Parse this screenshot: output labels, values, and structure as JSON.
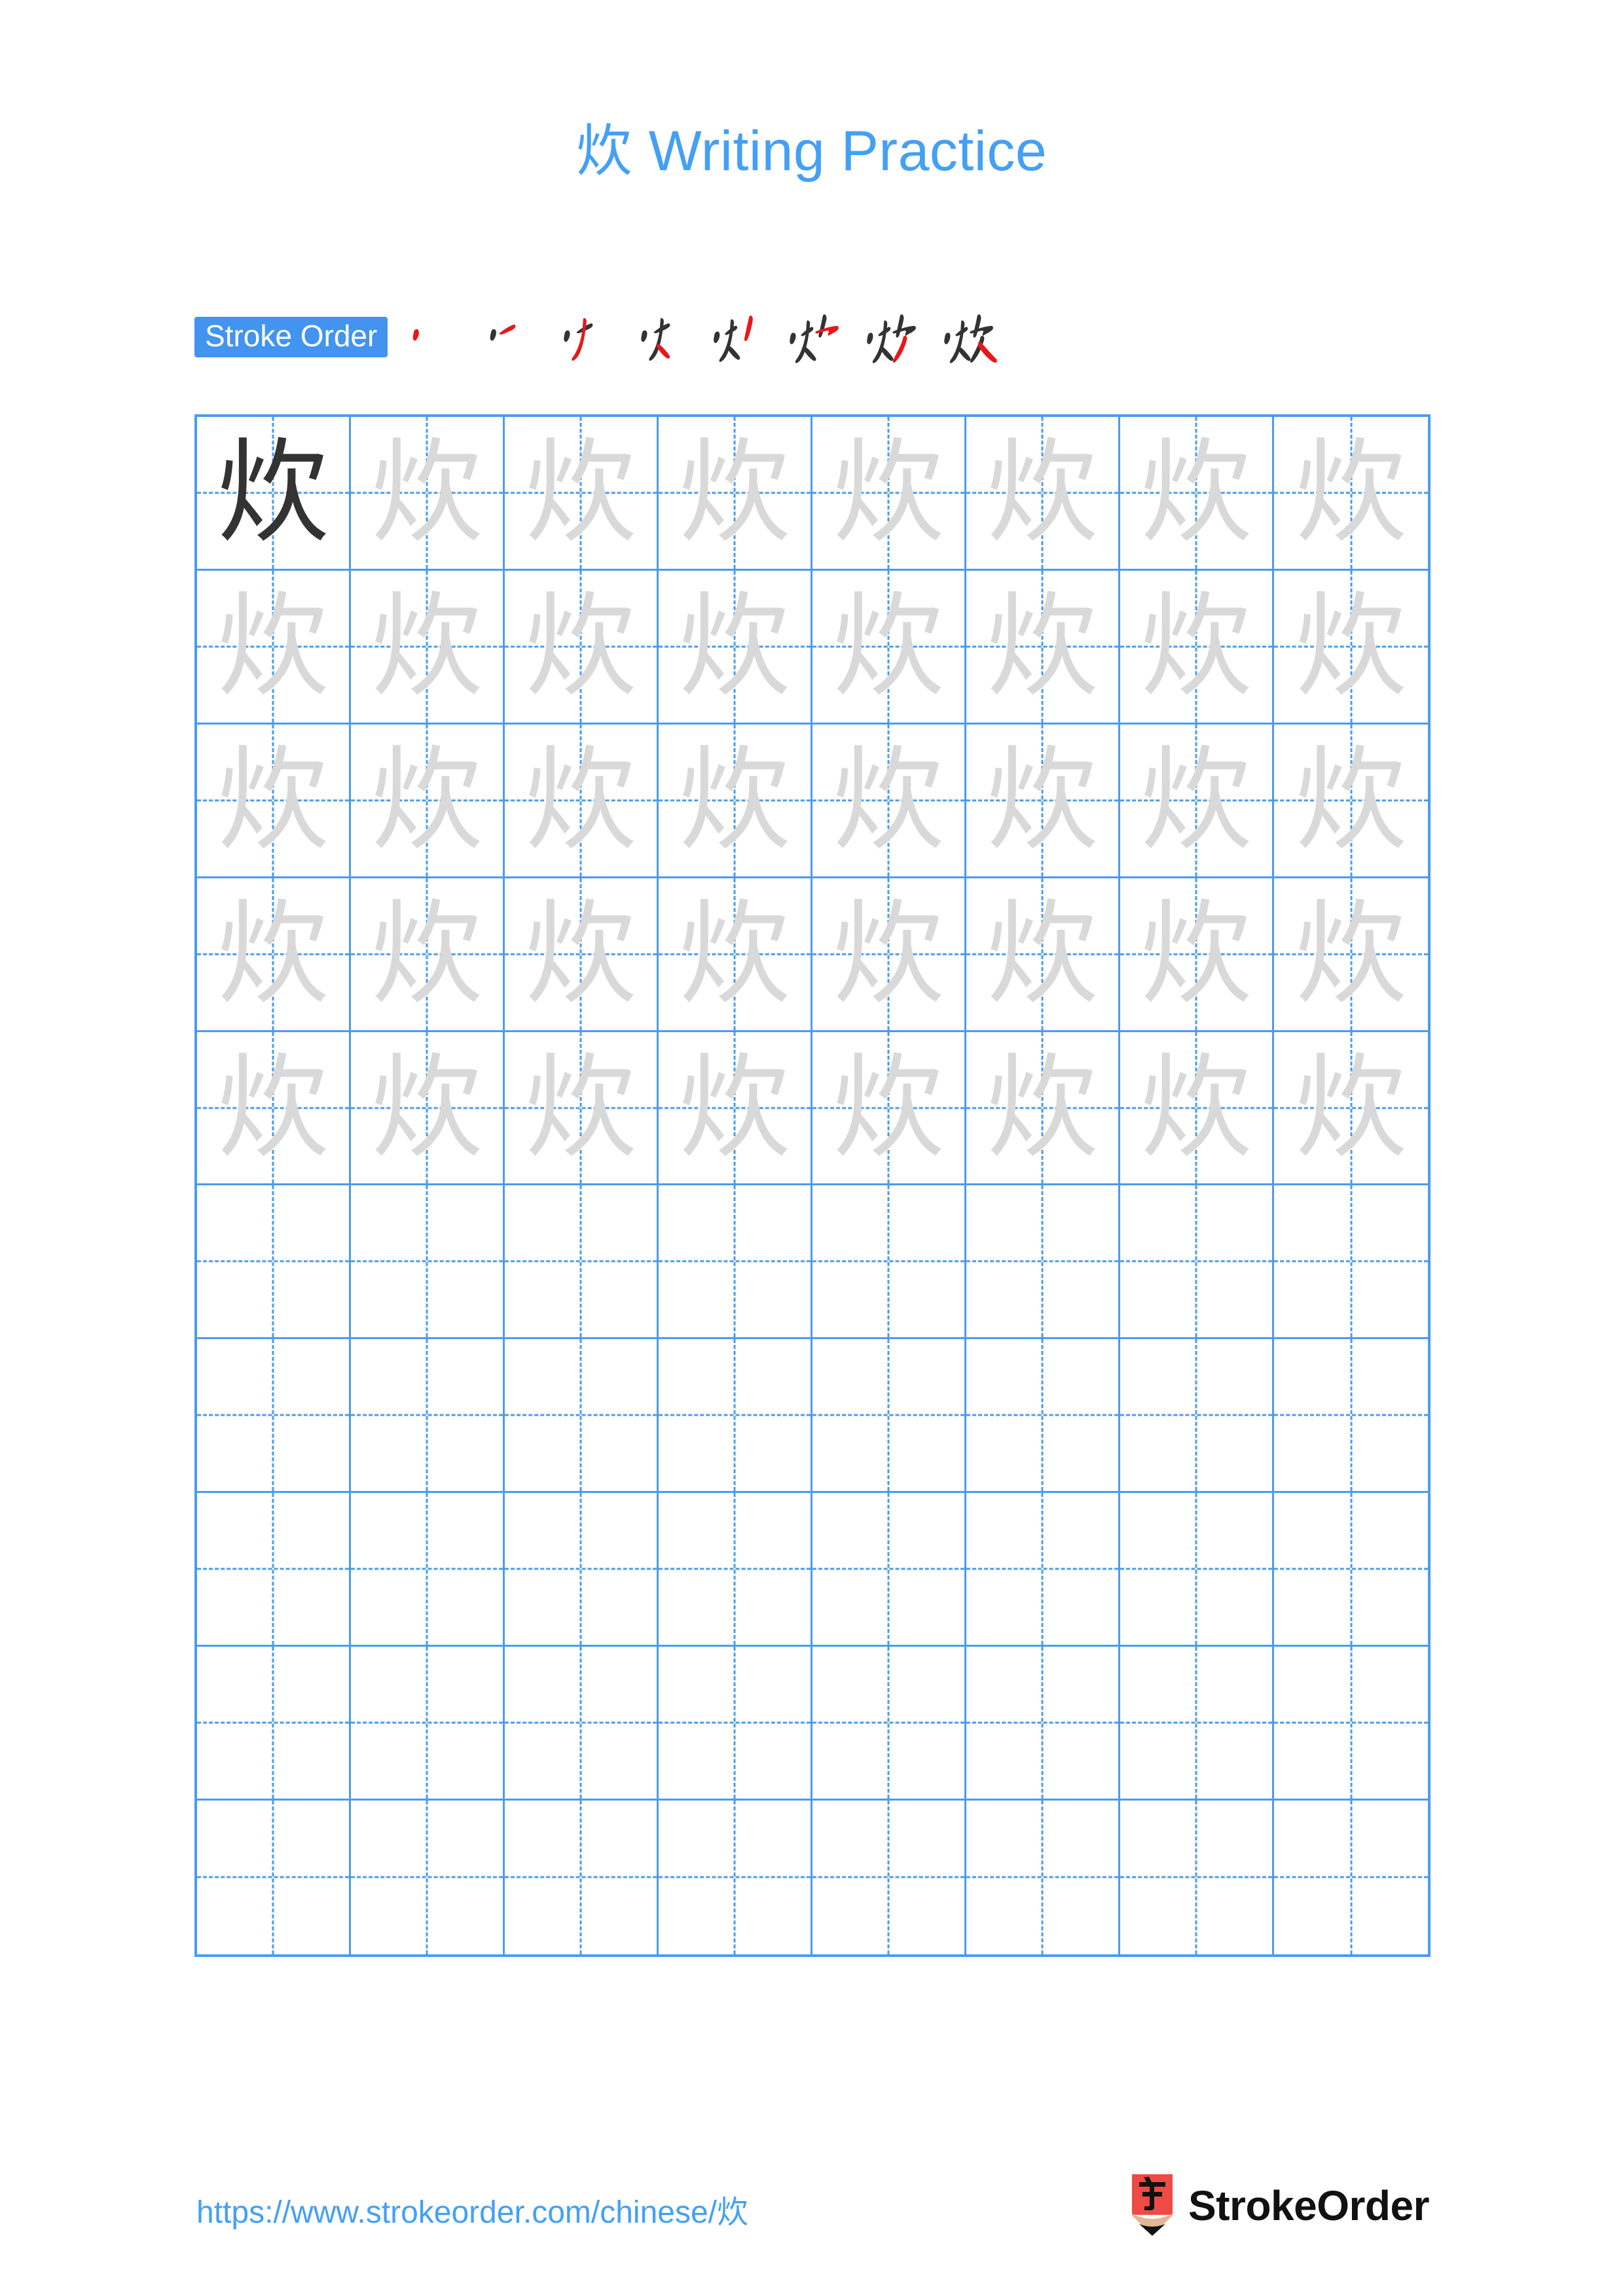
{
  "page": {
    "title": "炊 Writing Practice",
    "character": "炊",
    "background_color": "#ffffff",
    "accent_color": "#44a0f5"
  },
  "stroke_order": {
    "badge_label": "Stroke Order",
    "badge_bg_color": "#4294f0",
    "badge_text_color": "#ffffff",
    "total_strokes": 8,
    "new_stroke_color": "#e8171b",
    "existing_stroke_color": "#333333",
    "steps": [
      {
        "index": 1,
        "strokes_shown": 1
      },
      {
        "index": 2,
        "strokes_shown": 2
      },
      {
        "index": 3,
        "strokes_shown": 3
      },
      {
        "index": 4,
        "strokes_shown": 4
      },
      {
        "index": 5,
        "strokes_shown": 5
      },
      {
        "index": 6,
        "strokes_shown": 6
      },
      {
        "index": 7,
        "strokes_shown": 7
      },
      {
        "index": 8,
        "strokes_shown": 8
      }
    ]
  },
  "grid": {
    "columns": 8,
    "rows": 10,
    "line_color": "#4a9bf0",
    "guide_style": "dashed",
    "dark_char_color": "#333333",
    "trace_char_color": "#d9d9d9",
    "rows_data": [
      {
        "row": 1,
        "cells": [
          "dark",
          "light",
          "light",
          "light",
          "light",
          "light",
          "light",
          "light"
        ]
      },
      {
        "row": 2,
        "cells": [
          "light",
          "light",
          "light",
          "light",
          "light",
          "light",
          "light",
          "light"
        ]
      },
      {
        "row": 3,
        "cells": [
          "light",
          "light",
          "light",
          "light",
          "light",
          "light",
          "light",
          "light"
        ]
      },
      {
        "row": 4,
        "cells": [
          "light",
          "light",
          "light",
          "light",
          "light",
          "light",
          "light",
          "light"
        ]
      },
      {
        "row": 5,
        "cells": [
          "light",
          "light",
          "light",
          "light",
          "light",
          "light",
          "light",
          "light"
        ]
      },
      {
        "row": 6,
        "cells": [
          "empty",
          "empty",
          "empty",
          "empty",
          "empty",
          "empty",
          "empty",
          "empty"
        ]
      },
      {
        "row": 7,
        "cells": [
          "empty",
          "empty",
          "empty",
          "empty",
          "empty",
          "empty",
          "empty",
          "empty"
        ]
      },
      {
        "row": 8,
        "cells": [
          "empty",
          "empty",
          "empty",
          "empty",
          "empty",
          "empty",
          "empty",
          "empty"
        ]
      },
      {
        "row": 9,
        "cells": [
          "empty",
          "empty",
          "empty",
          "empty",
          "empty",
          "empty",
          "empty",
          "empty"
        ]
      },
      {
        "row": 10,
        "cells": [
          "empty",
          "empty",
          "empty",
          "empty",
          "empty",
          "empty",
          "empty",
          "empty"
        ]
      }
    ]
  },
  "footer": {
    "url": "https://www.strokeorder.com/chinese/炊",
    "url_color": "#44a0f5",
    "brand_name": "StrokeOrder",
    "logo_character": "字",
    "logo_body_color": "#ef4a45",
    "logo_wood_color": "#e0b896",
    "logo_tip_color": "#111111"
  }
}
